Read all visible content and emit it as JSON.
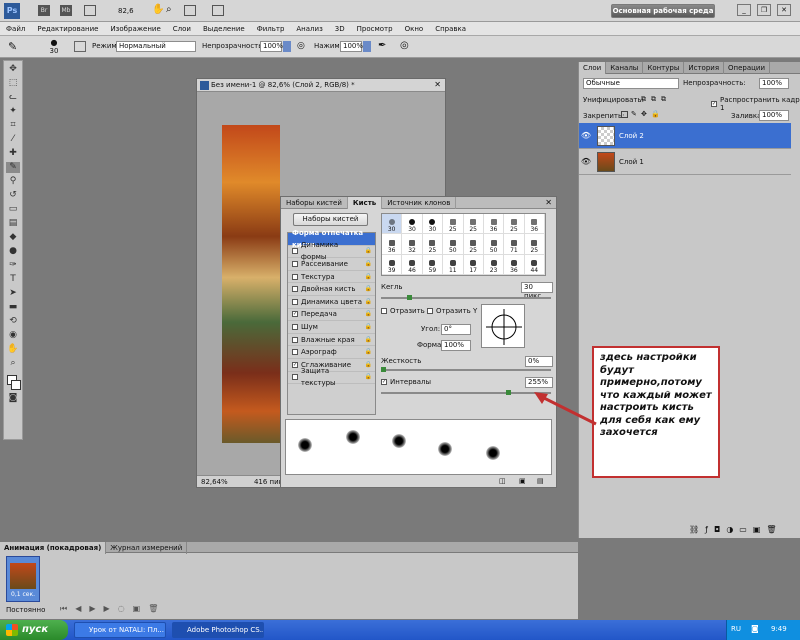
{
  "topbar": {
    "zoom": "82,6",
    "workspace_button": "Основная рабочая среда"
  },
  "menu": [
    "Файл",
    "Редактирование",
    "Изображение",
    "Слои",
    "Выделение",
    "Фильтр",
    "Анализ",
    "3D",
    "Просмотр",
    "Окно",
    "Справка"
  ],
  "options": {
    "brush_size": "30",
    "mode_label": "Режим:",
    "mode_value": "Нормальный",
    "opacity_label": "Непрозрачность:",
    "opacity_value": "100%",
    "pressure_label": "Нажим:",
    "pressure_value": "100%"
  },
  "document": {
    "title": "Без имени-1 @ 82,6% (Слой 2, RGB/8) *",
    "status_zoom": "82,64%",
    "status_size": "416 пикс."
  },
  "brush_panel": {
    "tabs": [
      "Наборы кистей",
      "Кисть",
      "Источник клонов"
    ],
    "presets_button": "Наборы кистей",
    "options": [
      {
        "label": "Форма отпечатка кисти",
        "checked": false,
        "head": true
      },
      {
        "label": "Динамика формы",
        "checked": false
      },
      {
        "label": "Рассеивание",
        "checked": false
      },
      {
        "label": "Текстура",
        "checked": false
      },
      {
        "label": "Двойная кисть",
        "checked": false
      },
      {
        "label": "Динамика цвета",
        "checked": false
      },
      {
        "label": "Передача",
        "checked": true
      },
      {
        "label": "Шум",
        "checked": false
      },
      {
        "label": "Влажные края",
        "checked": false
      },
      {
        "label": "Аэрограф",
        "checked": false
      },
      {
        "label": "Сглаживание",
        "checked": true
      },
      {
        "label": "Защита текстуры",
        "checked": false
      }
    ],
    "brushes": [
      "30",
      "30",
      "30",
      "25",
      "25",
      "36",
      "25",
      "36",
      "36",
      "32",
      "25",
      "50",
      "25",
      "50",
      "71",
      "25",
      "39",
      "46",
      "59",
      "11",
      "17",
      "23",
      "36",
      "44"
    ],
    "size_label": "Кегль",
    "size_value": "30 пикс.",
    "flip_x": "Отразить X",
    "flip_y": "Отразить Y",
    "angle_label": "Угол:",
    "angle_value": "0°",
    "roundness_label": "Форма:",
    "roundness_value": "100%",
    "hardness_label": "Жесткость",
    "hardness_value": "0%",
    "spacing_label": "Интервалы",
    "spacing_value": "255%",
    "size_fraction": 0.16,
    "hardness_fraction": 0.0,
    "spacing_fraction": 0.76
  },
  "layers_panel": {
    "tabs": [
      "Слои",
      "Каналы",
      "Контуры",
      "История",
      "Операции"
    ],
    "blend": "Обычные",
    "opacity_label": "Непрозрачность:",
    "opacity_value": "100%",
    "unify_label": "Унифицировать:",
    "propagate_label": "Распространить кадр 1",
    "lock_label": "Закрепить:",
    "fill_label": "Заливка:",
    "fill_value": "100%",
    "layers": [
      {
        "name": "Слой 2",
        "selected": true
      },
      {
        "name": "Слой 1",
        "selected": false
      }
    ]
  },
  "anim_panel": {
    "tabs": [
      "Анимация (покадровая)",
      "Журнал измерений"
    ],
    "frame_time": "0,1 сек.",
    "loop": "Постоянно"
  },
  "note": "здесь настройки будут примерно,потому что каждый может настроить кисть для себя  как ему захочется",
  "taskbar": {
    "start": "пуск",
    "items": [
      "Урок от NATALI: Пл...",
      "Adobe Photoshop CS..."
    ],
    "lang": "RU",
    "time": "9:49"
  }
}
